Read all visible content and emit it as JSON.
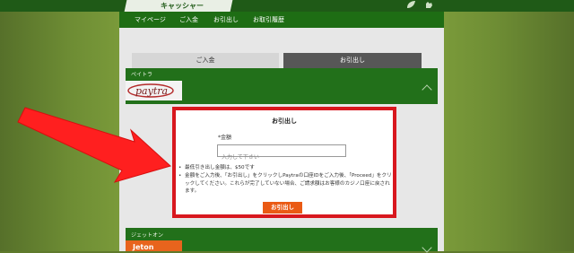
{
  "header": {
    "brand": "キャッシャー",
    "nav": [
      "マイページ",
      "ご入金",
      "お引出し",
      "お取引履歴"
    ]
  },
  "tabs": {
    "deposit": "ご入金",
    "withdraw": "お引出し"
  },
  "methods": [
    {
      "label": "ペイトラ",
      "logo": "paytra"
    },
    {
      "label": "ジェットオン",
      "logo": "Jeton"
    }
  ],
  "modal": {
    "title": "お引出し",
    "amount_label": "*金額",
    "amount_placeholder": "入力して下さい",
    "notes": [
      "最低引き出し金額は、$50です",
      "金額をご入力後、「お引出し」をクリックしPaytraの口座IDをご入力後、「Proceed」をクリックしてください。これらが完了していない場合、ご請求額はお客様のカジノ口座に戻されます。"
    ],
    "submit_label": "お引出し"
  },
  "colors": {
    "header_green": "#1f5a17",
    "band_green": "#22701a",
    "accent_orange": "#ea5a14",
    "modal_border_red": "#d8171e",
    "arrow_red": "#ff1f1f"
  }
}
